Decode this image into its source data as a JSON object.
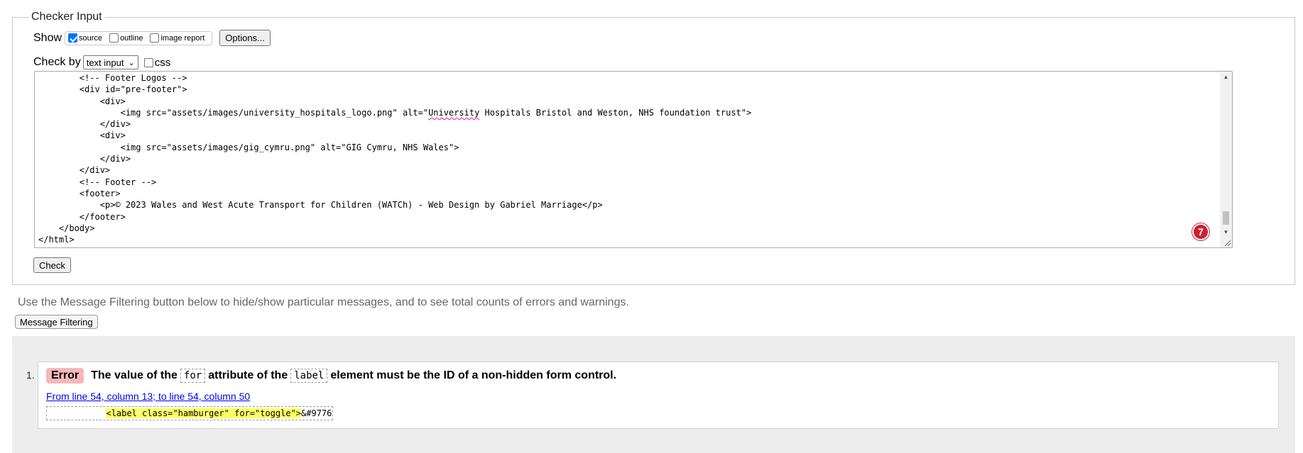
{
  "checker": {
    "legend": "Checker Input",
    "show_label": "Show",
    "show_options": [
      {
        "label": "source",
        "checked": true
      },
      {
        "label": "outline",
        "checked": false
      },
      {
        "label": "image report",
        "checked": false
      }
    ],
    "options_button": "Options...",
    "check_by_label": "Check by",
    "check_by_value": "text input",
    "css_label": "css",
    "css_checked": false,
    "source_lines": [
      "        <!-- Footer Logos -->",
      "        <div id=\"pre-footer\">",
      "            <div>",
      "                <img src=\"assets/images/university_hospitals_logo.png\" alt=\"University Hospitals Bristol and Weston, NHS foundation trust\">",
      "            </div>",
      "            <div>",
      "                <img src=\"assets/images/gig_cymru.png\" alt=\"GIG Cymru, NHS Wales\">",
      "            </div>",
      "        </div>",
      "        <!-- Footer -->",
      "        <footer>",
      "            <p>© 2023 Wales and West Acute Transport for Children (WATCh) - Web Design by Gabriel Marriage</p>",
      "        </footer>",
      "    </body>",
      "</html>"
    ],
    "badge_count": "7",
    "check_button": "Check"
  },
  "filter_hint": "Use the Message Filtering button below to hide/show particular messages, and to see total counts of errors and warnings.",
  "filter_button": "Message Filtering",
  "messages": [
    {
      "number": "1.",
      "type": "Error",
      "text_1": "The value of the",
      "code_1": "for",
      "text_2": "attribute of the",
      "code_2": "label",
      "text_3": "element must be the ID of a non-hidden form control.",
      "location": "From line 54, column 13; to line 54, column 50",
      "extract_prefix": "           ",
      "extract_highlight": "<label class=\"hamburger\" for=\"toggle\">",
      "extract_suffix": "&#9776"
    }
  ],
  "colors": {
    "error_badge": "#f5b8b8",
    "count_badge": "#cc1f35",
    "highlight": "#ffff66",
    "results_bg": "#ededed"
  }
}
